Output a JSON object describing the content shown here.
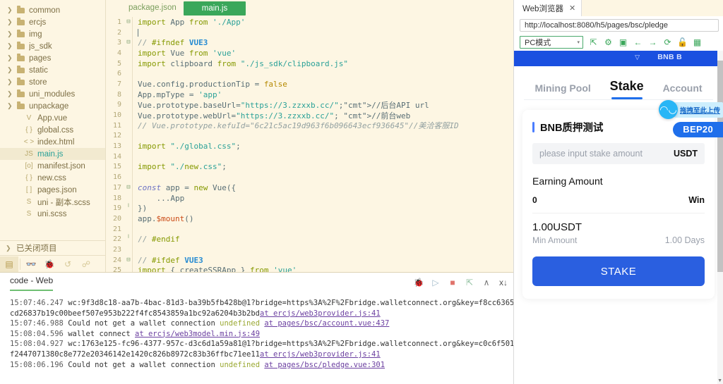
{
  "sidebar": {
    "tree": [
      {
        "label": "common",
        "type": "folder"
      },
      {
        "label": "ercjs",
        "type": "folder"
      },
      {
        "label": "img",
        "type": "folder"
      },
      {
        "label": "js_sdk",
        "type": "folder"
      },
      {
        "label": "pages",
        "type": "folder"
      },
      {
        "label": "static",
        "type": "folder"
      },
      {
        "label": "store",
        "type": "folder"
      },
      {
        "label": "uni_modules",
        "type": "folder"
      },
      {
        "label": "unpackage",
        "type": "folder"
      },
      {
        "label": "App.vue",
        "type": "file",
        "icon": "V"
      },
      {
        "label": "global.css",
        "type": "file",
        "icon": "{ }"
      },
      {
        "label": "index.html",
        "type": "file",
        "icon": "< >"
      },
      {
        "label": "main.js",
        "type": "file",
        "icon": "JS",
        "selected": true
      },
      {
        "label": "manifest.json",
        "type": "file",
        "icon": "[o]"
      },
      {
        "label": "new.css",
        "type": "file",
        "icon": "{ }"
      },
      {
        "label": "pages.json",
        "type": "file",
        "icon": "[ ]"
      },
      {
        "label": "uni - 副本.scss",
        "type": "file",
        "icon": "S"
      },
      {
        "label": "uni.scss",
        "type": "file",
        "icon": "S"
      }
    ],
    "closed_projects_label": "已关闭项目",
    "toolbar": [
      {
        "name": "files-icon",
        "glyph": "▤",
        "active": true
      },
      {
        "name": "search-icon",
        "glyph": "👓"
      },
      {
        "name": "debug-icon",
        "glyph": "🐞"
      },
      {
        "name": "history-icon",
        "glyph": "↺"
      },
      {
        "name": "plugin-icon",
        "glyph": "☍"
      }
    ]
  },
  "editor": {
    "tabs": [
      {
        "label": "package.json",
        "active": false
      },
      {
        "label": "main.js",
        "active": true
      }
    ],
    "lines": [
      {
        "n": 1,
        "fold": "minus"
      },
      {
        "n": 2,
        "fold": ""
      },
      {
        "n": 3,
        "fold": "minus"
      },
      {
        "n": 4,
        "fold": ""
      },
      {
        "n": 5,
        "fold": ""
      },
      {
        "n": 6,
        "fold": ""
      },
      {
        "n": 7,
        "fold": ""
      },
      {
        "n": 8,
        "fold": ""
      },
      {
        "n": 9,
        "fold": ""
      },
      {
        "n": 10,
        "fold": ""
      },
      {
        "n": 11,
        "fold": ""
      },
      {
        "n": 12,
        "fold": ""
      },
      {
        "n": 13,
        "fold": ""
      },
      {
        "n": 14,
        "fold": ""
      },
      {
        "n": 15,
        "fold": ""
      },
      {
        "n": 16,
        "fold": ""
      },
      {
        "n": 17,
        "fold": "minus"
      },
      {
        "n": 18,
        "fold": ""
      },
      {
        "n": 19,
        "fold": "end"
      },
      {
        "n": 20,
        "fold": ""
      },
      {
        "n": 21,
        "fold": ""
      },
      {
        "n": 22,
        "fold": "end"
      },
      {
        "n": 23,
        "fold": ""
      },
      {
        "n": 24,
        "fold": "minus"
      },
      {
        "n": 25,
        "fold": ""
      }
    ],
    "source": [
      "import App from './App'",
      "",
      "// #ifndef VUE3",
      "import Vue from 'vue'",
      "import clipboard from \"./js_sdk/clipboard.js\"",
      "",
      "Vue.config.productionTip = false",
      "App.mpType = 'app'",
      "Vue.prototype.baseUrl=\"https://3.zzxxb.cc/\";//后台API url",
      "Vue.prototype.webUrl=\"https://3.zzxxb.cc/\"; //前台web",
      "// Vue.prototype.kefuId=\"6c21c5ac19d963f6b096643ecf936645\"//美洽客服ID",
      "",
      "import \"./global.css\";",
      "",
      "import \"./new.css\";",
      "",
      "const app = new Vue({",
      "    ...App",
      "})",
      "app.$mount()",
      "",
      "// #endif",
      "",
      "// #ifdef VUE3",
      "import { createSSRApp } from 'vue'"
    ]
  },
  "console": {
    "tab_label": "code - Web",
    "tools": [
      {
        "name": "bug-icon",
        "glyph": "🐞"
      },
      {
        "name": "run-icon",
        "glyph": "▷"
      },
      {
        "name": "stop-icon",
        "glyph": "■"
      },
      {
        "name": "export-icon",
        "glyph": "⇱"
      },
      {
        "name": "collapse-icon",
        "glyph": "∧"
      },
      {
        "name": "clear-icon",
        "glyph": "x↓"
      }
    ],
    "logs": [
      {
        "time": "15:07:46.247",
        "message": "wc:9f3d8c18-aa7b-4bac-81d3-ba39b5fb428b@1?bridge=https%3A%2F%2Fbridge.walletconnect.org&key=f8cc6365cd26837b19c00beef507e953b222f4fc8543859a1bc92a6204b3b2bd",
        "ref": "at ercjs/web3provider.js:41"
      },
      {
        "time": "15:07:46.988",
        "message": "Could not get a wallet connection ",
        "undef": "undefined",
        "ref": "at pages/bsc/account.vue:437"
      },
      {
        "time": "15:08:04.596",
        "message": "wallet connect ",
        "ref": "at ercjs/web3model.min.js:49"
      },
      {
        "time": "15:08:04.927",
        "message": "wc:1763e125-fc96-4377-957c-d3c6d1a59a81@1?bridge=https%3A%2F%2Fbridge.walletconnect.org&key=c0c6f501f2447071380c8e772e20346142e1420c826b8972c83b36ffbc71ee11",
        "ref": "at ercjs/web3provider.js:41"
      },
      {
        "time": "15:08:06.196",
        "message": "Could not get a wallet connection ",
        "undef": "undefined",
        "ref": "at pages/bsc/pledge.vue:301"
      }
    ]
  },
  "browser": {
    "tab_label": "Web浏览器",
    "close_glyph": "✕",
    "url": "http://localhost:8080/h5/pages/bsc/pledge",
    "mode_label": "PC模式",
    "mode_caret": "▾",
    "toolbar_icons": [
      {
        "name": "open-external-icon",
        "glyph": "⇱"
      },
      {
        "name": "settings-gear-icon",
        "glyph": "⚙"
      },
      {
        "name": "console-icon",
        "glyph": "▣"
      },
      {
        "name": "back-arrow-icon",
        "glyph": "←"
      },
      {
        "name": "forward-arrow-icon",
        "glyph": "→"
      },
      {
        "name": "reload-icon",
        "glyph": "⟳"
      },
      {
        "name": "lock-icon",
        "glyph": "🔓"
      },
      {
        "name": "qrcode-icon",
        "glyph": "▦"
      }
    ]
  },
  "page": {
    "status_bar": {
      "wifi_glyph": "▽",
      "network_label": "BNB B"
    },
    "upload_badge": {
      "icon_glyph": "◠◡",
      "label": "拖拽至此上传"
    },
    "chain_badge": "BEP20",
    "tabs": [
      {
        "label": "Mining Pool",
        "active": false
      },
      {
        "label": "Stake",
        "active": true
      },
      {
        "label": "Account",
        "active": false
      }
    ],
    "card": {
      "title": "BNB质押测试",
      "amount_placeholder": "please input stake amount",
      "amount_unit": "USDT",
      "earning_title": "Earning Amount",
      "earning_value": "0",
      "earning_label": "Win",
      "min_amount_value": "1.00USDT",
      "min_amount_label": "Min Amount",
      "days_value": "1.00 Days",
      "stake_button": "STAKE"
    }
  },
  "colors": {
    "editor_bg": "#fdf6e3",
    "tab_active": "#3aa75a",
    "brand_blue": "#1f6feb",
    "stake_blue": "#2a5fe0",
    "upload_cyan": "#29b6f6"
  }
}
